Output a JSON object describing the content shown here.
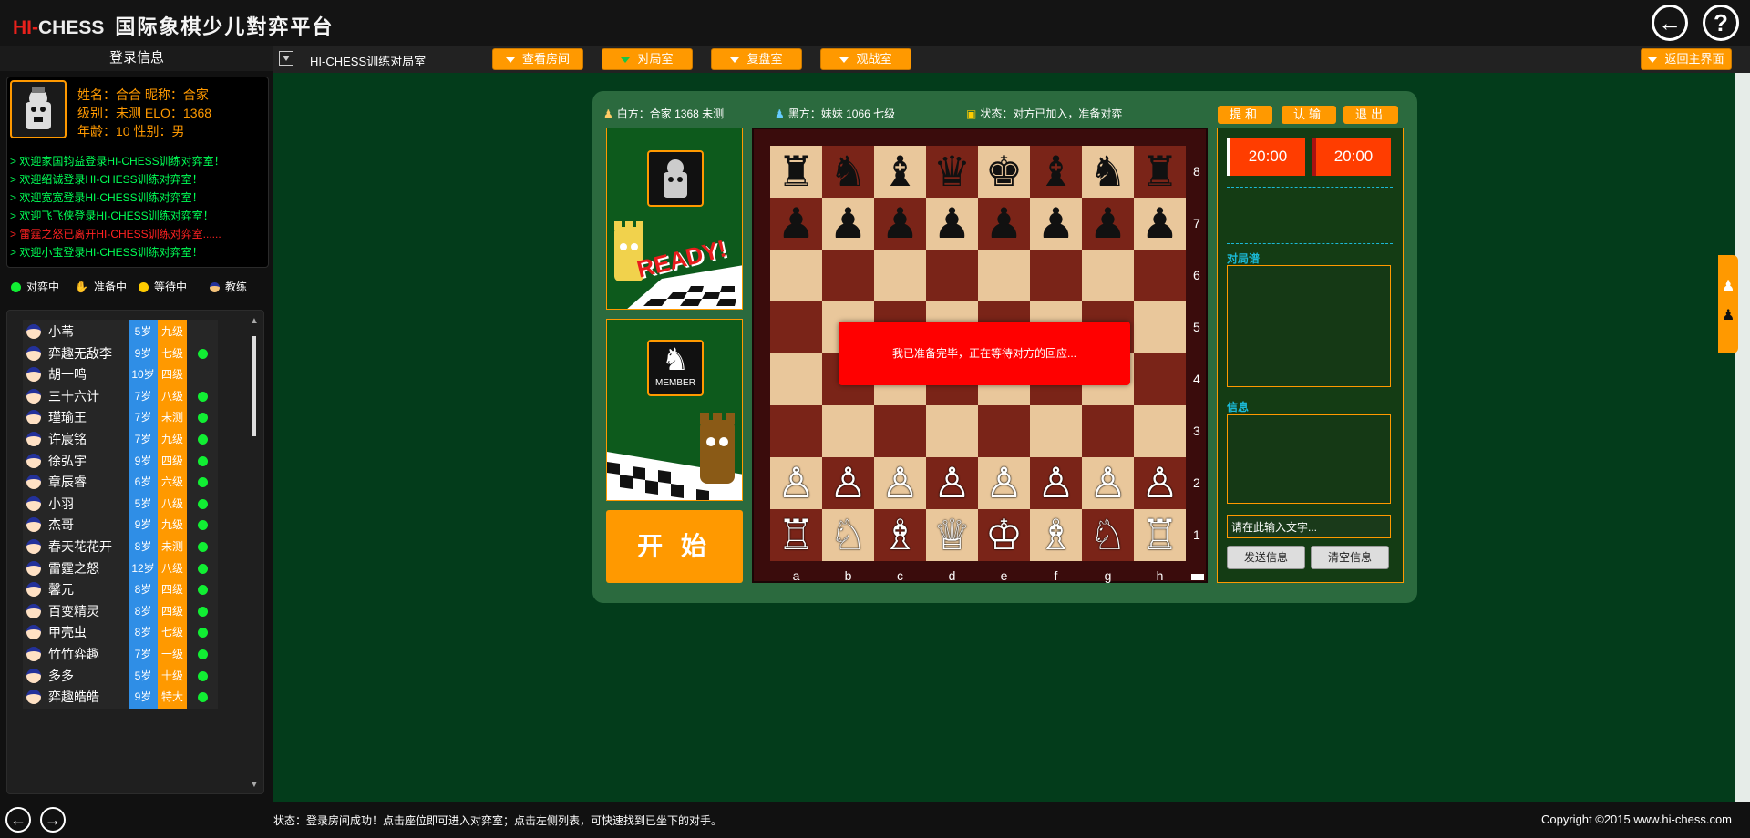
{
  "header": {
    "brand_hi": "HI-",
    "brand_chess": "CHESS",
    "brand_cn": "国际象棋少儿對弈平台",
    "back_icon": "←",
    "help_icon": "?"
  },
  "left": {
    "login_title": "登录信息",
    "profile": {
      "line1": "姓名：合合 昵称：合家",
      "line2": "级别：未测 ELO：1368",
      "line3": "年龄：10 性别：男"
    },
    "messages": [
      {
        "text": "> 欢迎家国钧益登录HI-CHESS训练对弈室！",
        "type": "green"
      },
      {
        "text": "> 欢迎绍诚登录HI-CHESS训练对弈室！",
        "type": "green"
      },
      {
        "text": "> 欢迎宽宽登录HI-CHESS训练对弈室！",
        "type": "green"
      },
      {
        "text": "> 欢迎飞飞侠登录HI-CHESS训练对弈室！",
        "type": "green"
      },
      {
        "text": "> 雷霆之怒已离开HI-CHESS训练对弈室......",
        "type": "red"
      },
      {
        "text": "> 欢迎小宝登录HI-CHESS训练对弈室！",
        "type": "green"
      }
    ],
    "legend": {
      "playing": "对弈中",
      "ready": "准备中",
      "waiting": "等待中",
      "coach": "教练"
    },
    "players": [
      {
        "name": "小苇",
        "age": "5岁",
        "level": "九级",
        "online": false
      },
      {
        "name": "弈趣无敌李",
        "age": "9岁",
        "level": "七级",
        "online": true
      },
      {
        "name": "胡一鸣",
        "age": "10岁",
        "level": "四级",
        "online": false
      },
      {
        "name": "三十六计",
        "age": "7岁",
        "level": "八级",
        "online": true
      },
      {
        "name": "瑾瑜王",
        "age": "7岁",
        "level": "未测",
        "online": true
      },
      {
        "name": "许宸铭",
        "age": "7岁",
        "level": "九级",
        "online": true
      },
      {
        "name": "徐弘宇",
        "age": "9岁",
        "level": "四级",
        "online": true
      },
      {
        "name": "章辰睿",
        "age": "6岁",
        "level": "六级",
        "online": true
      },
      {
        "name": "小羽",
        "age": "5岁",
        "level": "八级",
        "online": true
      },
      {
        "name": "杰哥",
        "age": "9岁",
        "level": "九级",
        "online": true
      },
      {
        "name": "春天花花开",
        "age": "8岁",
        "level": "未测",
        "online": true
      },
      {
        "name": "雷霆之怒",
        "age": "12岁",
        "level": "八级",
        "online": true
      },
      {
        "name": "馨元",
        "age": "8岁",
        "level": "四级",
        "online": true
      },
      {
        "name": "百变精灵",
        "age": "8岁",
        "level": "四级",
        "online": true
      },
      {
        "name": "甲壳虫",
        "age": "8岁",
        "level": "七级",
        "online": true
      },
      {
        "name": "竹竹弈趣",
        "age": "7岁",
        "level": "一级",
        "online": true
      },
      {
        "name": "多多",
        "age": "5岁",
        "level": "十级",
        "online": true
      },
      {
        "name": "弈趣皓皓",
        "age": "9岁",
        "level": "特大",
        "online": true
      }
    ]
  },
  "toolbar": {
    "title": "HI-CHESS训练对局室",
    "view_room": "查看房间",
    "game_room": "对局室",
    "review_room": "复盘室",
    "watch_room": "观战室",
    "back_main": "返回主界面"
  },
  "game": {
    "white_player": "白方：合家 1368 未测",
    "black_player": "黑方：妹妹 1066 七级",
    "status": "状态：对方已加入，准备对弈",
    "ready_text": "READY!",
    "member_text": "MEMBER",
    "start_label": "开 始",
    "wait_message": "我已准备完毕，正在等待对方的回应...",
    "ranks": [
      "8",
      "7",
      "6",
      "5",
      "4",
      "3",
      "2",
      "1"
    ],
    "files": [
      "a",
      "b",
      "c",
      "d",
      "e",
      "f",
      "g",
      "h"
    ],
    "board": [
      [
        "♜",
        "♞",
        "♝",
        "♛",
        "♚",
        "♝",
        "♞",
        "♜"
      ],
      [
        "♟",
        "♟",
        "♟",
        "♟",
        "♟",
        "♟",
        "♟",
        "♟"
      ],
      [
        "",
        "",
        "",
        "",
        "",
        "",
        "",
        ""
      ],
      [
        "",
        "",
        "",
        "",
        "",
        "",
        "",
        ""
      ],
      [
        "",
        "",
        "",
        "",
        "",
        "",
        "",
        ""
      ],
      [
        "",
        "",
        "",
        "",
        "",
        "",
        "",
        ""
      ],
      [
        "♙",
        "♙",
        "♙",
        "♙",
        "♙",
        "♙",
        "♙",
        "♙"
      ],
      [
        "♖",
        "♘",
        "♗",
        "♕",
        "♔",
        "♗",
        "♘",
        "♖"
      ]
    ]
  },
  "right_pane": {
    "draw": "提和",
    "resign": "认输",
    "exit": "退出",
    "clock_white": "20:00",
    "clock_black": "20:00",
    "record_label": "对局谱",
    "info_label": "信息",
    "input_placeholder": "请在此输入文字...",
    "send": "发送信息",
    "clear": "清空信息"
  },
  "statusbar": {
    "text": "状态：登录房间成功！点击座位即可进入对弈室；点击左侧列表，可快速找到已坐下的对手。",
    "copyright": "Copyright ©2015 www.hi-chess.com",
    "prev_icon": "←",
    "next_icon": "→"
  },
  "colors": {
    "accent": "#ff9900",
    "main_bg": "#033c1b",
    "online": "#11ee33"
  }
}
